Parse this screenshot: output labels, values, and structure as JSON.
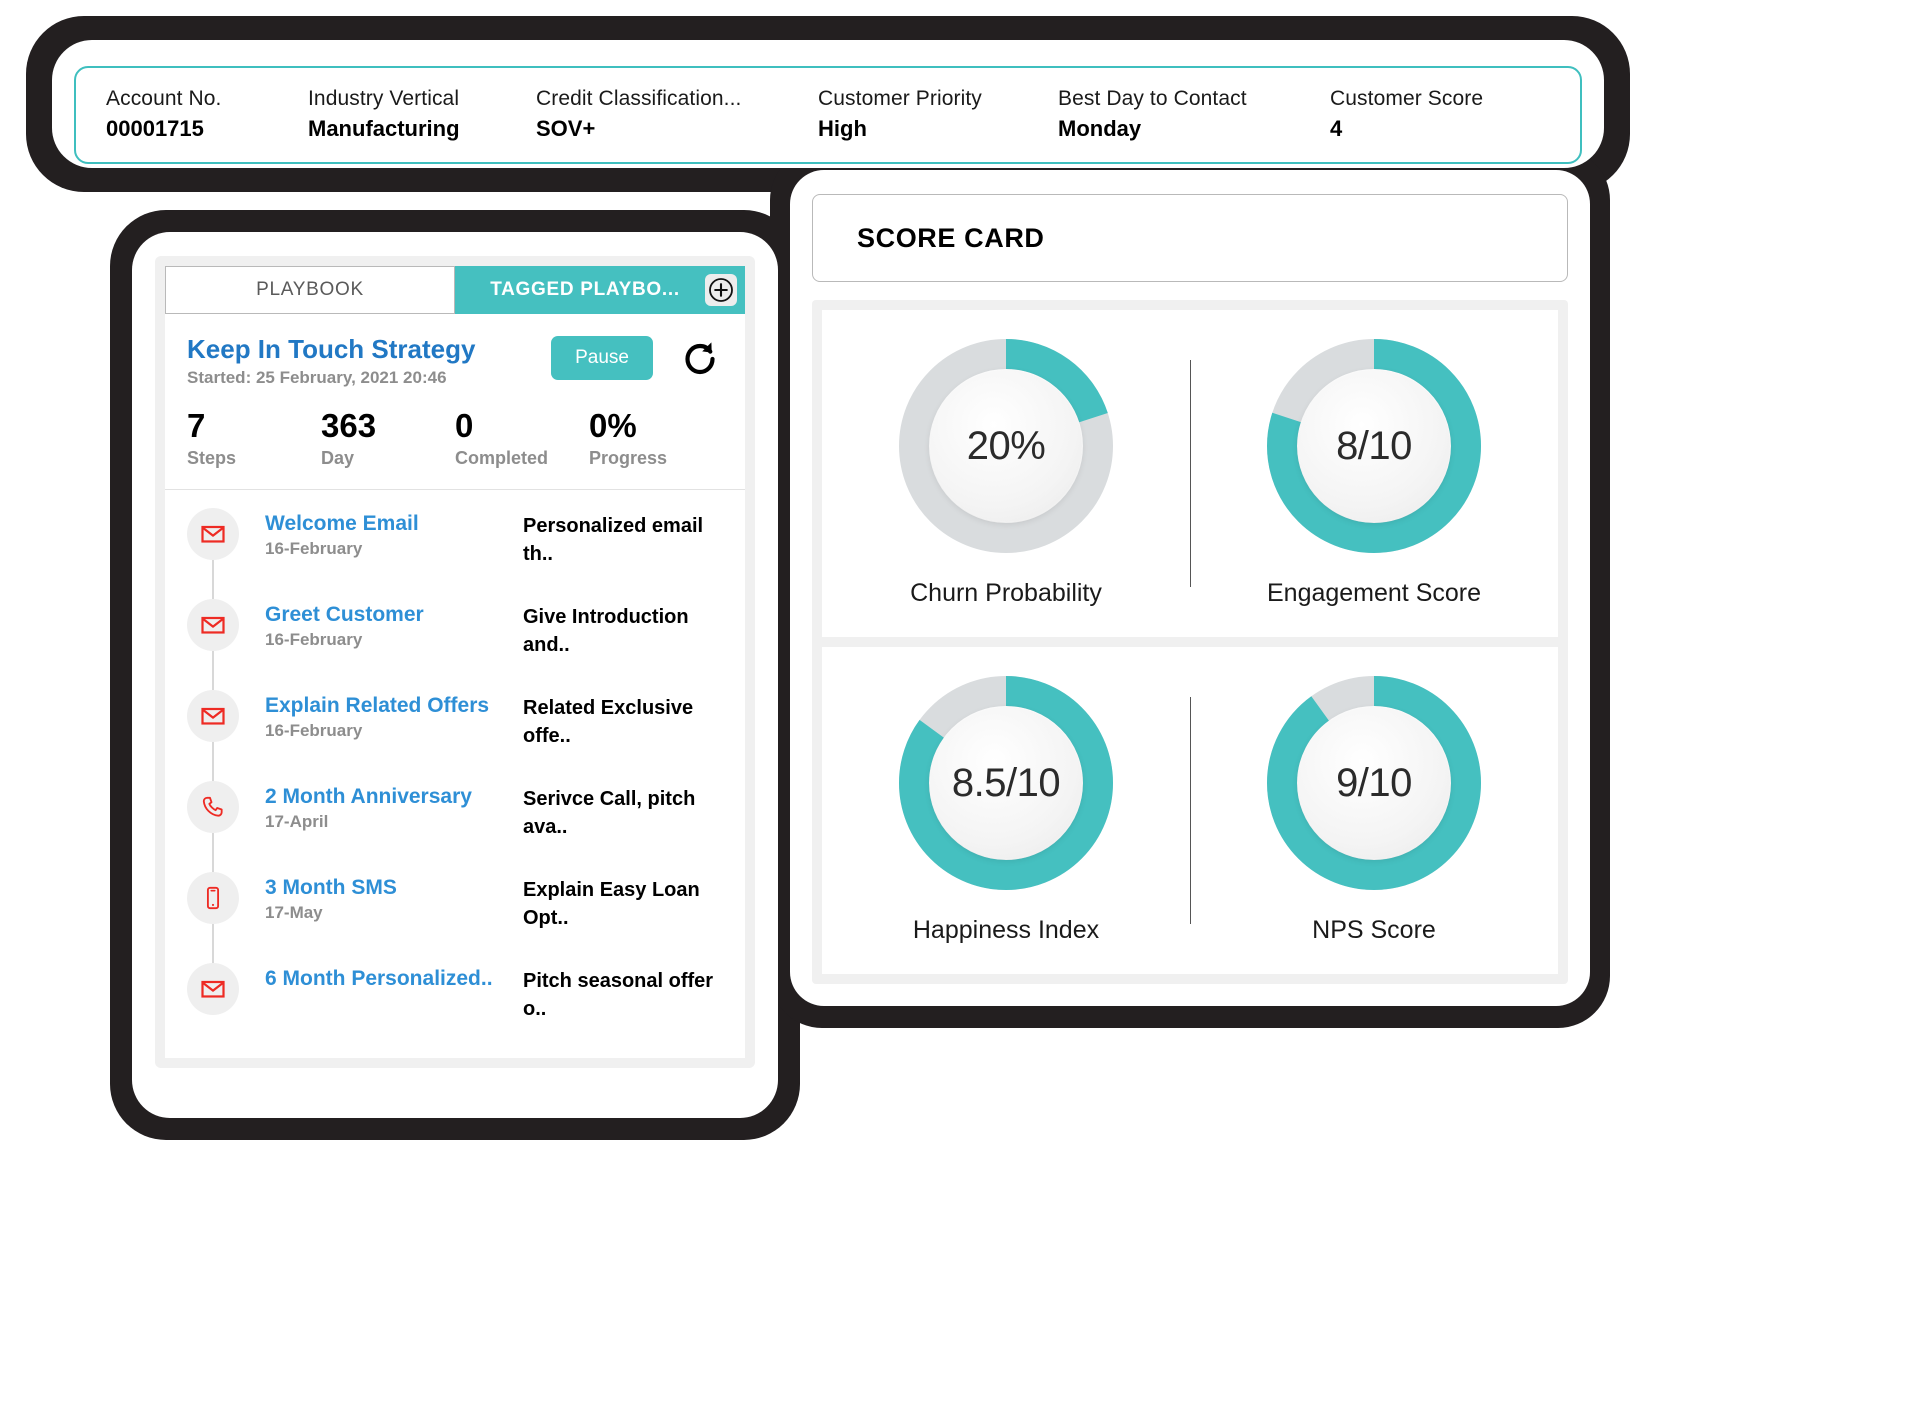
{
  "header": {
    "fields": [
      {
        "label": "Account No.",
        "value": "00001715"
      },
      {
        "label": "Industry Vertical",
        "value": "Manufacturing"
      },
      {
        "label": "Credit Classification...",
        "value": "SOV+"
      },
      {
        "label": "Customer Priority",
        "value": "High"
      },
      {
        "label": "Best Day to Contact",
        "value": "Monday"
      },
      {
        "label": "Customer Score",
        "value": "4"
      }
    ]
  },
  "playbook": {
    "tabs": [
      {
        "label": "PLAYBOOK",
        "active": false
      },
      {
        "label": "TAGGED PLAYBO...",
        "active": true
      }
    ],
    "add_button_icon": "plus-circle-icon",
    "strategy_title": "Keep In Touch Strategy",
    "started_text": "Started: 25 February, 2021 20:46",
    "pause_label": "Pause",
    "refresh_icon": "refresh-icon",
    "stats": [
      {
        "value": "7",
        "label": "Steps"
      },
      {
        "value": "363",
        "label": "Day"
      },
      {
        "value": "0",
        "label": "Completed"
      },
      {
        "value": "0%",
        "label": "Progress"
      }
    ],
    "steps": [
      {
        "icon": "email-icon",
        "title": "Welcome Email",
        "date": "16-February",
        "desc": "Personalized email th.."
      },
      {
        "icon": "email-icon",
        "title": "Greet Customer",
        "date": "16-February",
        "desc": "Give Introduction and.."
      },
      {
        "icon": "email-icon",
        "title": "Explain Related Offers",
        "date": "16-February",
        "desc": "Related Exclusive offe.."
      },
      {
        "icon": "phone-icon",
        "title": "2 Month Anniversary",
        "date": "17-April",
        "desc": "Serivce Call, pitch ava.."
      },
      {
        "icon": "sms-icon",
        "title": "3 Month SMS",
        "date": "17-May",
        "desc": "Explain Easy Loan Opt.."
      },
      {
        "icon": "email-icon",
        "title": "6 Month Personalized..",
        "date": "",
        "desc": "Pitch seasonal offer o.."
      }
    ]
  },
  "scorecard": {
    "title": "SCORE CARD",
    "gauges": [
      {
        "label": "Churn Probability",
        "value": "20%",
        "percent": 20
      },
      {
        "label": "Engagement Score",
        "value": "8/10",
        "percent": 80
      },
      {
        "label": "Happiness Index",
        "value": "8.5/10",
        "percent": 85
      },
      {
        "label": "NPS Score",
        "value": "9/10",
        "percent": 90
      }
    ]
  },
  "colors": {
    "accent_teal": "#45c0c0",
    "link_blue": "#2e8fd6",
    "title_blue": "#2178c4",
    "track_grey": "#d9dcde",
    "icon_red": "#ee2b24",
    "bezel_dark": "#231f20"
  }
}
